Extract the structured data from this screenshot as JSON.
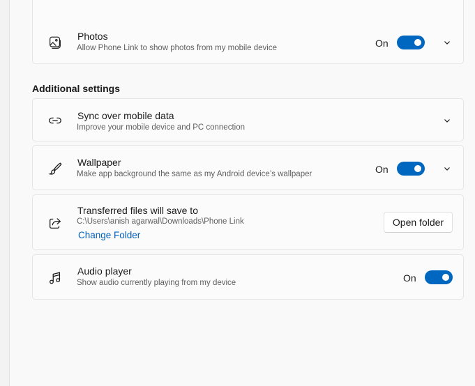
{
  "photos": {
    "title": "Photos",
    "description": "Allow Phone Link to show photos from my mobile device",
    "state": "On",
    "icon": "photos-icon"
  },
  "additional_heading": "Additional settings",
  "sync": {
    "title": "Sync over mobile data",
    "description": "Improve your mobile device and PC connection",
    "icon": "link-icon"
  },
  "wallpaper": {
    "title": "Wallpaper",
    "description": "Make app background the same as my Android device’s wallpaper",
    "state": "On",
    "icon": "brush-icon"
  },
  "transfer": {
    "title": "Transferred files will save to",
    "path": "C:\\Users\\anish agarwal\\Downloads\\Phone Link",
    "link": "Change Folder",
    "button": "Open folder",
    "icon": "share-icon"
  },
  "audio": {
    "title": "Audio player",
    "description": "Show audio currently playing from my device",
    "state": "On",
    "icon": "music-note-icon"
  },
  "colors": {
    "accent": "#0067c0",
    "link": "#005fb8"
  }
}
